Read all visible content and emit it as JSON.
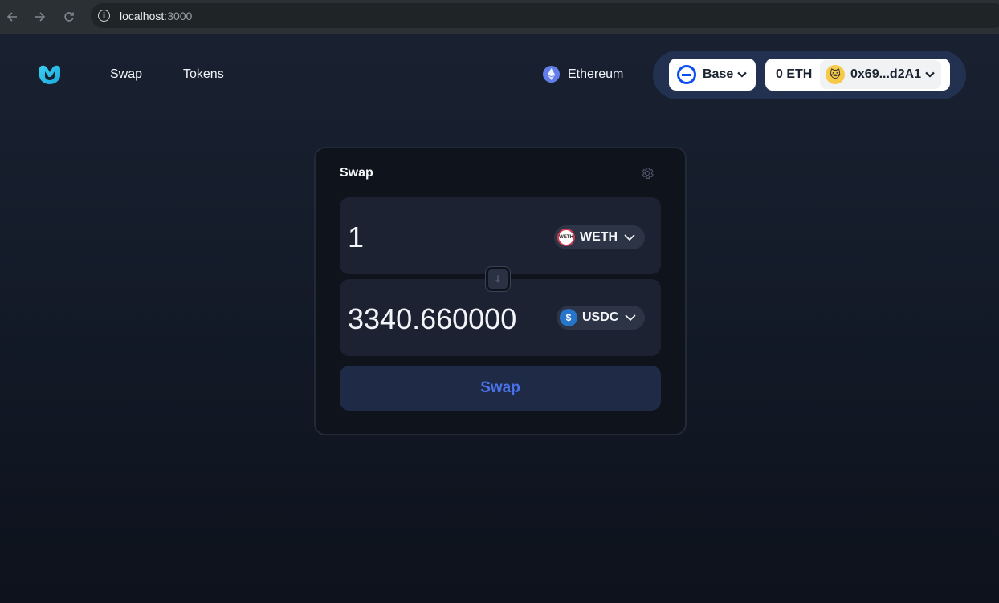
{
  "browser": {
    "url_host": "localhost",
    "url_port": ":3000"
  },
  "nav": {
    "items": [
      {
        "label": "Swap"
      },
      {
        "label": "Tokens"
      }
    ]
  },
  "network": {
    "label": "Ethereum",
    "icon": "ethereum-icon"
  },
  "wallet": {
    "chain_label": "Base",
    "chain_icon": "base-icon",
    "balance": "0 ETH",
    "address": "0x69...d2A1",
    "avatar_emoji": "🐱"
  },
  "swap": {
    "title": "Swap",
    "from": {
      "amount": "1",
      "token": "WETH",
      "token_icon_text": "WETH"
    },
    "to": {
      "amount": "3340.660000",
      "token": "USDC",
      "token_icon_text": "$"
    },
    "flip_icon": "↓",
    "button_label": "Swap"
  },
  "colors": {
    "accent": "#4a72e8",
    "base_blue": "#0b4cf0",
    "logo_cyan": "#22c4e8",
    "card_bg": "#0f131c",
    "panel_bg": "#1c2231"
  }
}
